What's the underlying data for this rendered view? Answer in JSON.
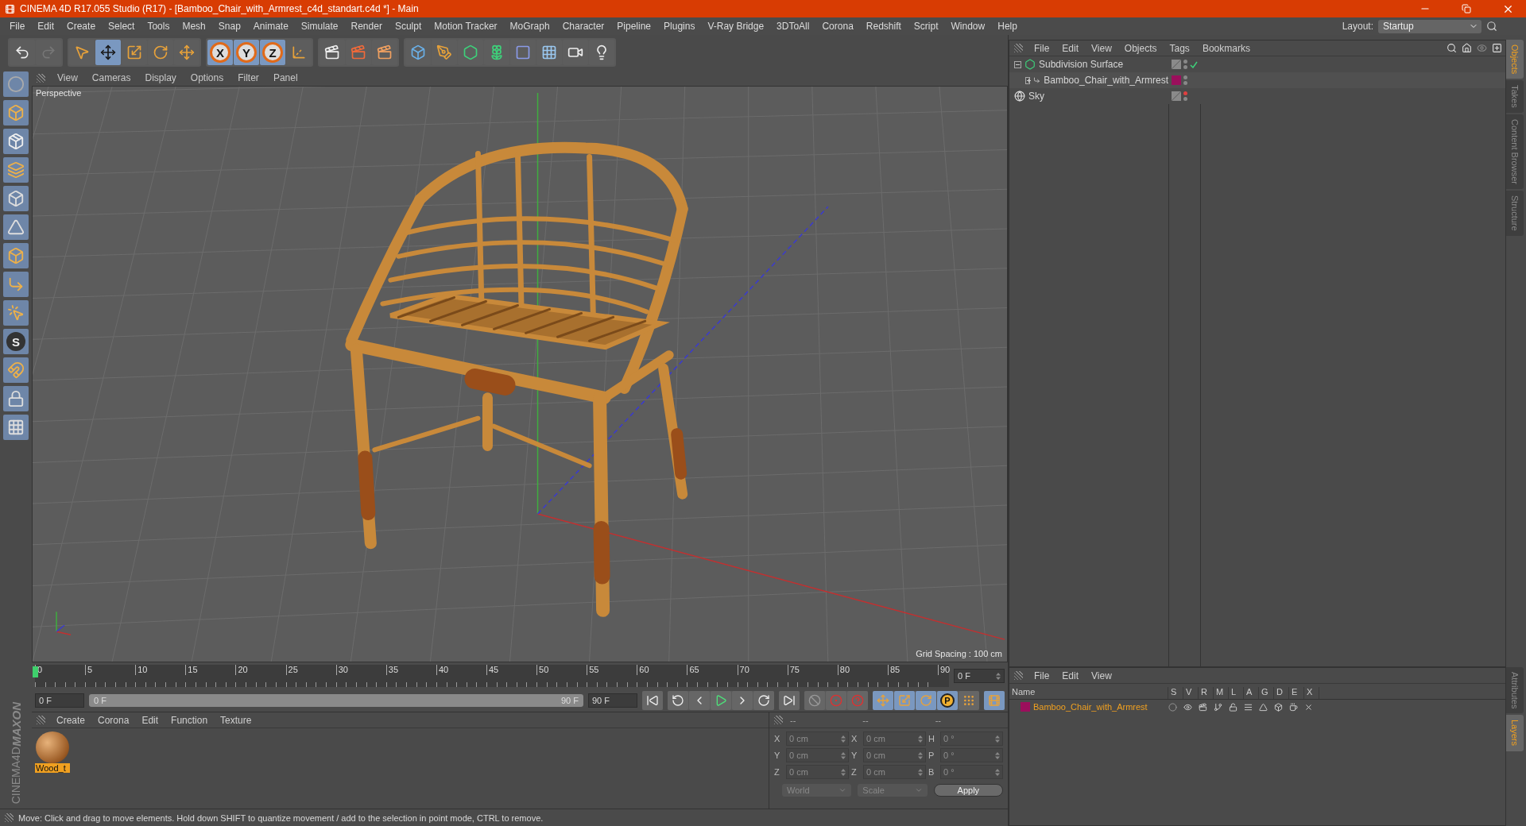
{
  "window": {
    "title": "CINEMA 4D R17.055 Studio (R17) - [Bamboo_Chair_with_Armrest_c4d_standart.c4d *] - Main"
  },
  "menu": [
    "File",
    "Edit",
    "Create",
    "Select",
    "Tools",
    "Mesh",
    "Snap",
    "Animate",
    "Simulate",
    "Render",
    "Sculpt",
    "Motion Tracker",
    "MoGraph",
    "Character",
    "Pipeline",
    "Plugins",
    "V-Ray Bridge",
    "3DToAll",
    "Corona",
    "Redshift",
    "Script",
    "Window",
    "Help"
  ],
  "layout": {
    "label": "Layout:",
    "value": "Startup"
  },
  "toolbar": {
    "tools": [
      {
        "kind": "select",
        "selected": false
      },
      {
        "kind": "move",
        "selected": true
      },
      {
        "kind": "scale",
        "selected": false
      },
      {
        "kind": "rotate",
        "selected": false
      }
    ],
    "axis_buttons": [
      {
        "label": "X",
        "on": true
      },
      {
        "label": "Y",
        "on": true
      },
      {
        "label": "Z",
        "on": true
      }
    ]
  },
  "tool_column": {
    "snap_letter": "S"
  },
  "viewport": {
    "menu": [
      "View",
      "Cameras",
      "Display",
      "Options",
      "Filter",
      "Panel"
    ],
    "camera": "Perspective",
    "grid_spacing": "Grid Spacing : 100 cm"
  },
  "timeline": {
    "ticks": [
      "0",
      "5",
      "10",
      "15",
      "20",
      "25",
      "30",
      "35",
      "40",
      "45",
      "50",
      "55",
      "60",
      "65",
      "70",
      "75",
      "80",
      "85",
      "90"
    ],
    "frame": "0 F"
  },
  "transport": {
    "start": "0 F",
    "range_start": "0 F",
    "range_end": "90 F",
    "end": "90 F",
    "param_letter": "P",
    "range": {
      "level": 1
    }
  },
  "materials": {
    "menu": [
      "Create",
      "Corona",
      "Edit",
      "Function",
      "Texture"
    ],
    "items": [
      {
        "name": "Wood_t",
        "selected": true
      }
    ]
  },
  "logo": {
    "brand": "MAXON",
    "product": "CINEMA4D"
  },
  "coordinates": {
    "headers": [
      "--",
      "--",
      "--"
    ],
    "rows": [
      [
        {
          "axis": "X",
          "value": "0 cm"
        },
        {
          "axis": "X",
          "value": "0 cm"
        },
        {
          "axis": "H",
          "value": "0 °"
        }
      ],
      [
        {
          "axis": "Y",
          "value": "0 cm"
        },
        {
          "axis": "Y",
          "value": "0 cm"
        },
        {
          "axis": "P",
          "value": "0 °"
        }
      ],
      [
        {
          "axis": "Z",
          "value": "0 cm"
        },
        {
          "axis": "Z",
          "value": "0 cm"
        },
        {
          "axis": "B",
          "value": "0 °"
        }
      ]
    ],
    "dropdowns": [
      "World",
      "Scale"
    ],
    "apply": "Apply"
  },
  "status_bar": "Move: Click and drag to move elements. Hold down SHIFT to quantize movement / add to the selection in point mode, CTRL to remove.",
  "objects": {
    "menu": [
      "File",
      "Edit",
      "View",
      "Objects",
      "Tags",
      "Bookmarks"
    ],
    "items": [
      {
        "name": "Subdivision Surface",
        "kind": "subdivision",
        "expanded": true,
        "enabled": true,
        "render_visible": true,
        "children": [
          {
            "name": "Bamboo_Chair_with_Armrest",
            "kind": "null",
            "expanded": false,
            "render_visible": true,
            "color": "#9b0f5c"
          }
        ]
      },
      {
        "name": "Sky",
        "kind": "sky",
        "render_visible": false
      }
    ]
  },
  "side_tabs": [
    {
      "label": "Objects",
      "selected": true
    },
    {
      "label": "Takes",
      "selected": false
    },
    {
      "label": "Content Browser",
      "selected": false
    },
    {
      "label": "Structure",
      "selected": false
    }
  ],
  "layers": {
    "menu": [
      "File",
      "Edit",
      "View"
    ],
    "columns": [
      "Name",
      "S",
      "V",
      "R",
      "M",
      "L",
      "A",
      "G",
      "D",
      "E",
      "X"
    ],
    "rows": [
      {
        "name": "Bamboo_Chair_with_Armrest",
        "color": "#9b0f5c"
      }
    ]
  },
  "bottom_tabs": [
    {
      "label": "Attributes",
      "selected": false
    },
    {
      "label": "Layers",
      "selected": true
    }
  ]
}
